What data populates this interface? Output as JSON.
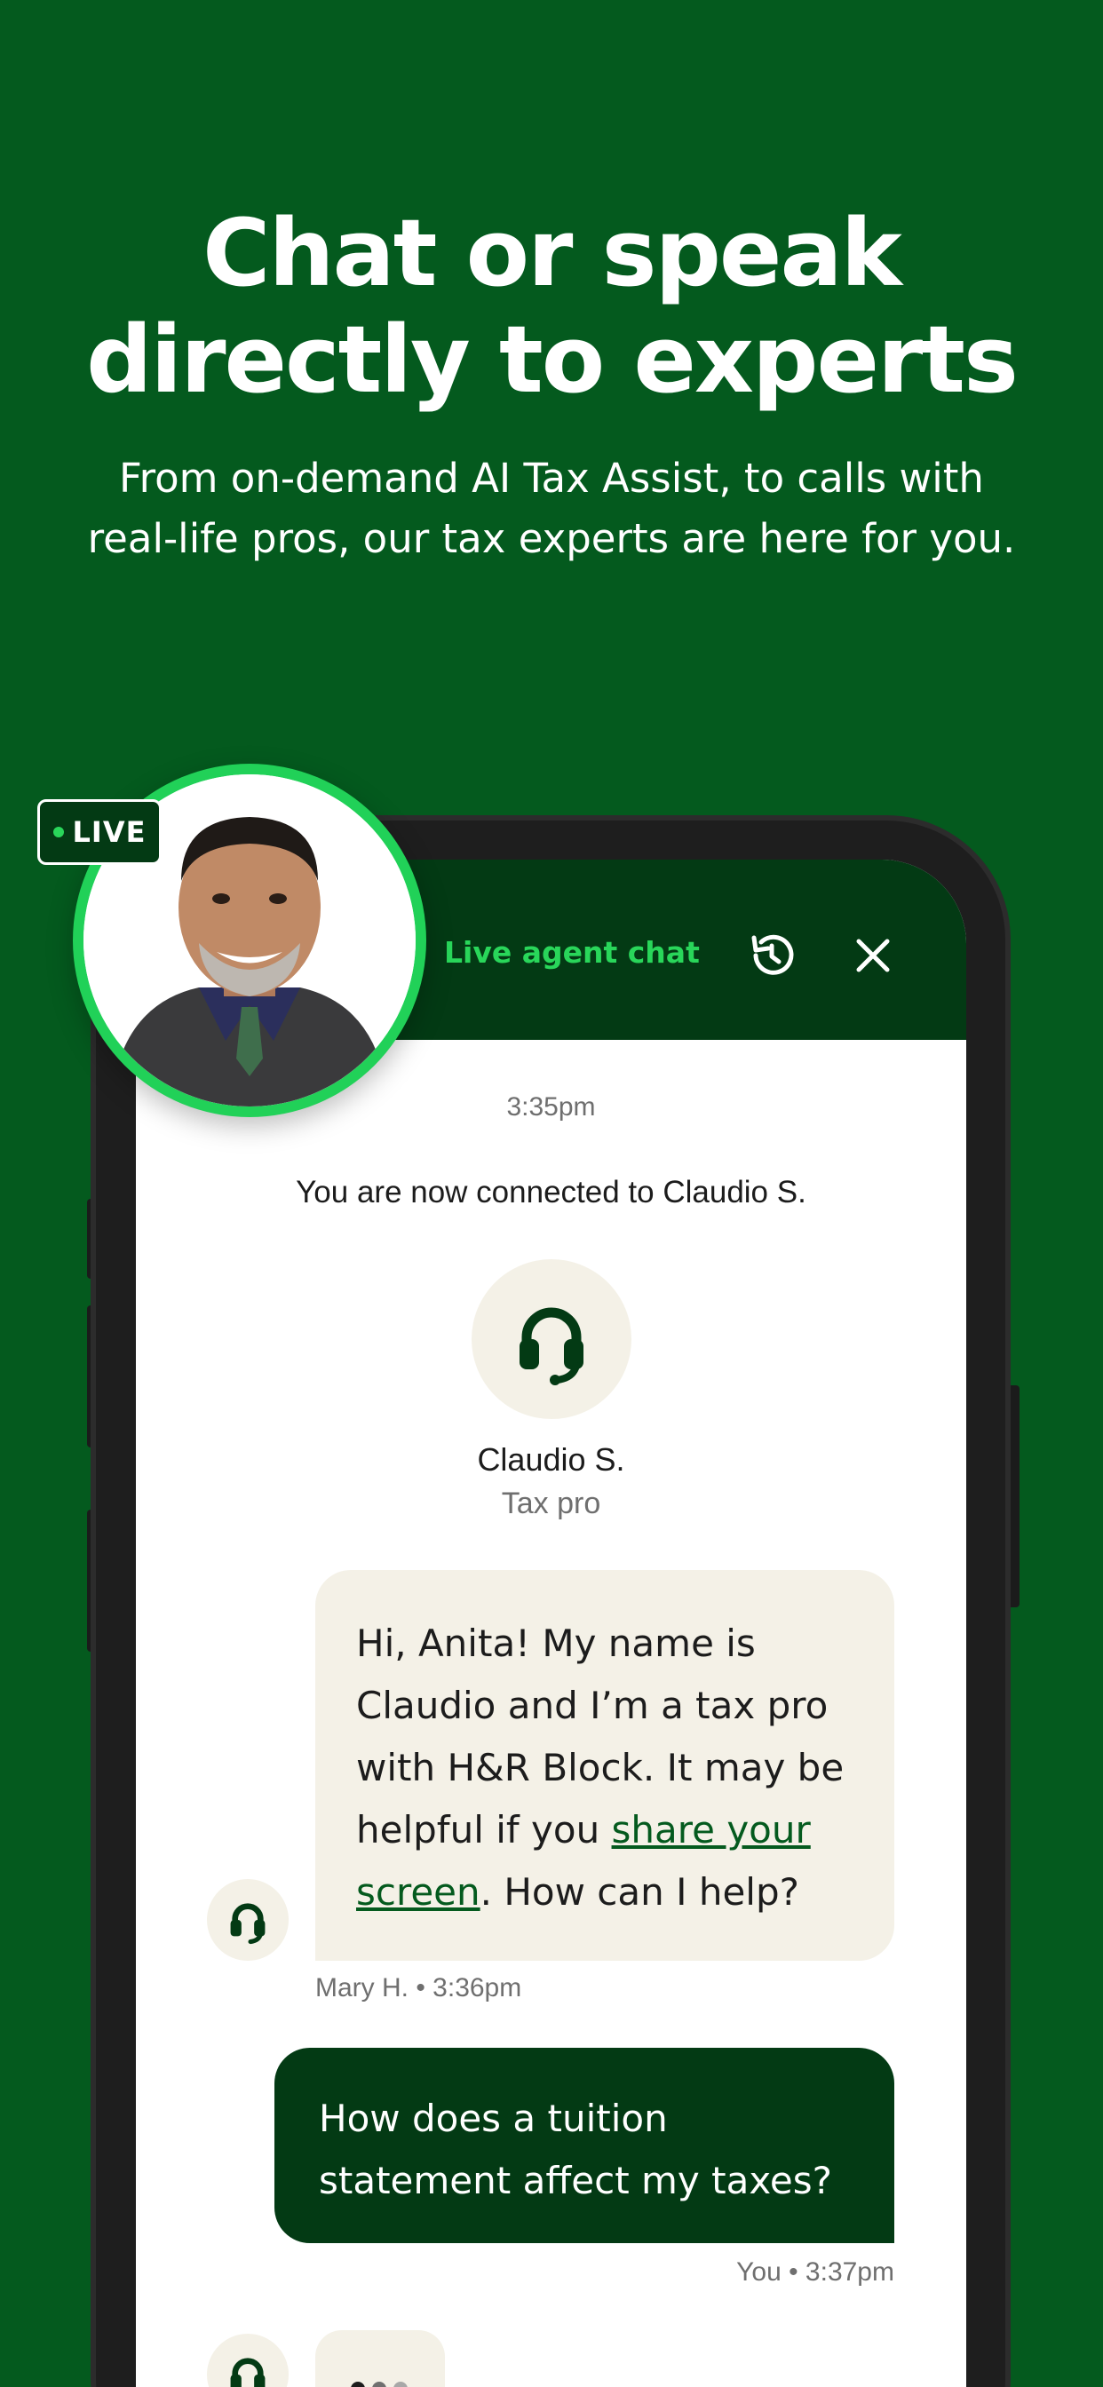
{
  "hero": {
    "headline_line1": "Chat or speak",
    "headline_line2": "directly to experts",
    "subhead_line1": "From on-demand AI Tax Assist, to calls with",
    "subhead_line2": "real-life pros, our tax experts are here for you."
  },
  "badge": {
    "label": "LIVE"
  },
  "chat": {
    "title": "Live agent chat",
    "history_icon": "history-icon",
    "close_icon": "close-icon",
    "timestamp": "3:35pm",
    "connected_text": "You are now connected to Claudio S.",
    "agent": {
      "name": "Claudio S.",
      "role": "Tax pro",
      "icon": "headset-icon"
    },
    "messages": [
      {
        "from": "agent",
        "text_before": "Hi, Anita! My name is Claudio and I’m a tax pro with H&R Block. It may be helpful if you ",
        "link_text": "share your screen",
        "text_after": ". How can I help?",
        "meta": "Mary H. • 3:36pm"
      },
      {
        "from": "user",
        "text": "How does a tuition statement affect my taxes?",
        "meta": "You • 3:37pm"
      }
    ]
  },
  "colors": {
    "background": "#045a1e",
    "header": "#033a14",
    "accent": "#29d65a",
    "bubble_in": "#f4f1e7"
  }
}
